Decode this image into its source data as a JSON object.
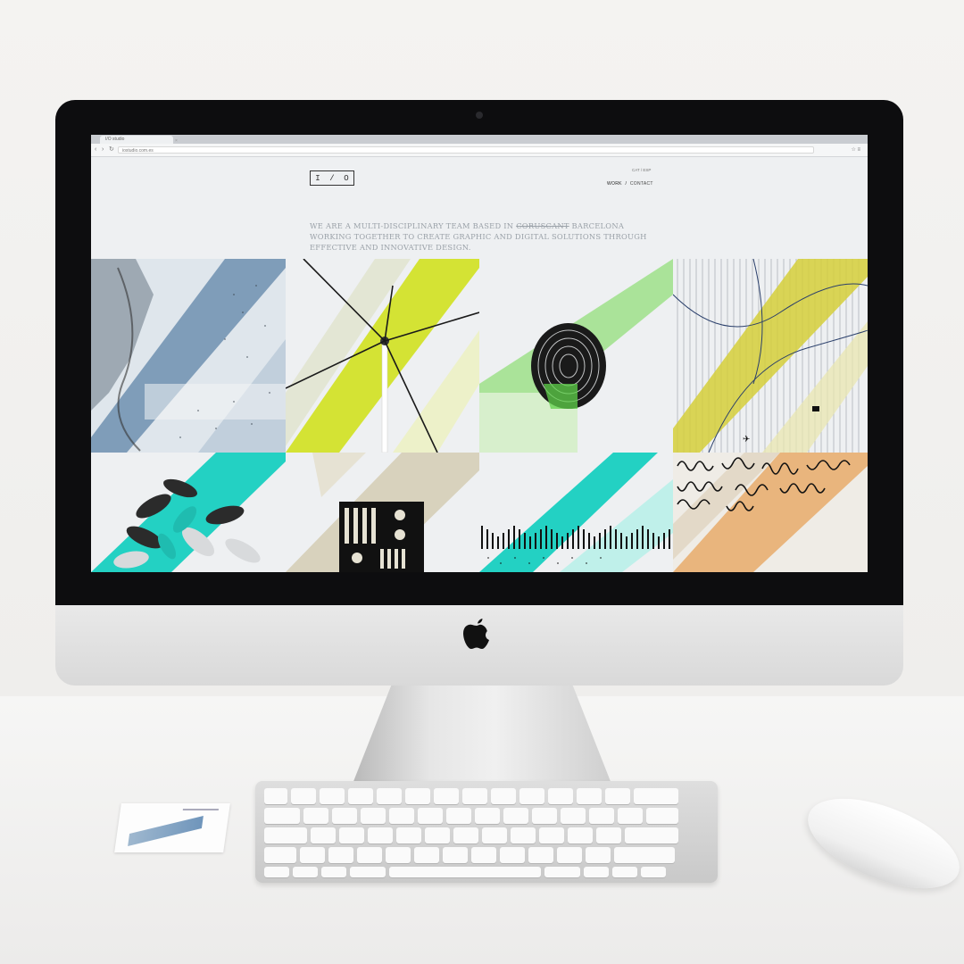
{
  "browser": {
    "tab_title": "I/O studio",
    "tab_close": "×",
    "url": "iostudio.com.es",
    "back": "‹",
    "forward": "›",
    "reload": "↻",
    "toolbar_icons": "☆ ≡"
  },
  "site": {
    "logo_left": "I",
    "logo_slash": "/",
    "logo_right": "O",
    "lang": "CAT / ESP",
    "nav": {
      "work": "WORK",
      "separator": "/",
      "contact": "CONTACT"
    },
    "intro": {
      "before_strike": "WE ARE A MULTI-DISCIPLINARY TEAM BASED IN ",
      "struck": "CORUSCANT",
      "after_strike": " BARCELONA WORKING TOGETHER TO CREATE GRAPHIC AND DIGITAL SOLUTIONS THROUGH EFFECTIVE AND INNOVATIVE DESIGN."
    }
  },
  "colors": {
    "accent_blue": "#6e8fb0",
    "accent_lime": "#d4e334",
    "accent_green": "#9ee08a",
    "accent_olive": "#d5cf3a",
    "accent_teal": "#23d1c3",
    "accent_sand": "#d8d2bd",
    "accent_orange": "#e9b57d"
  }
}
